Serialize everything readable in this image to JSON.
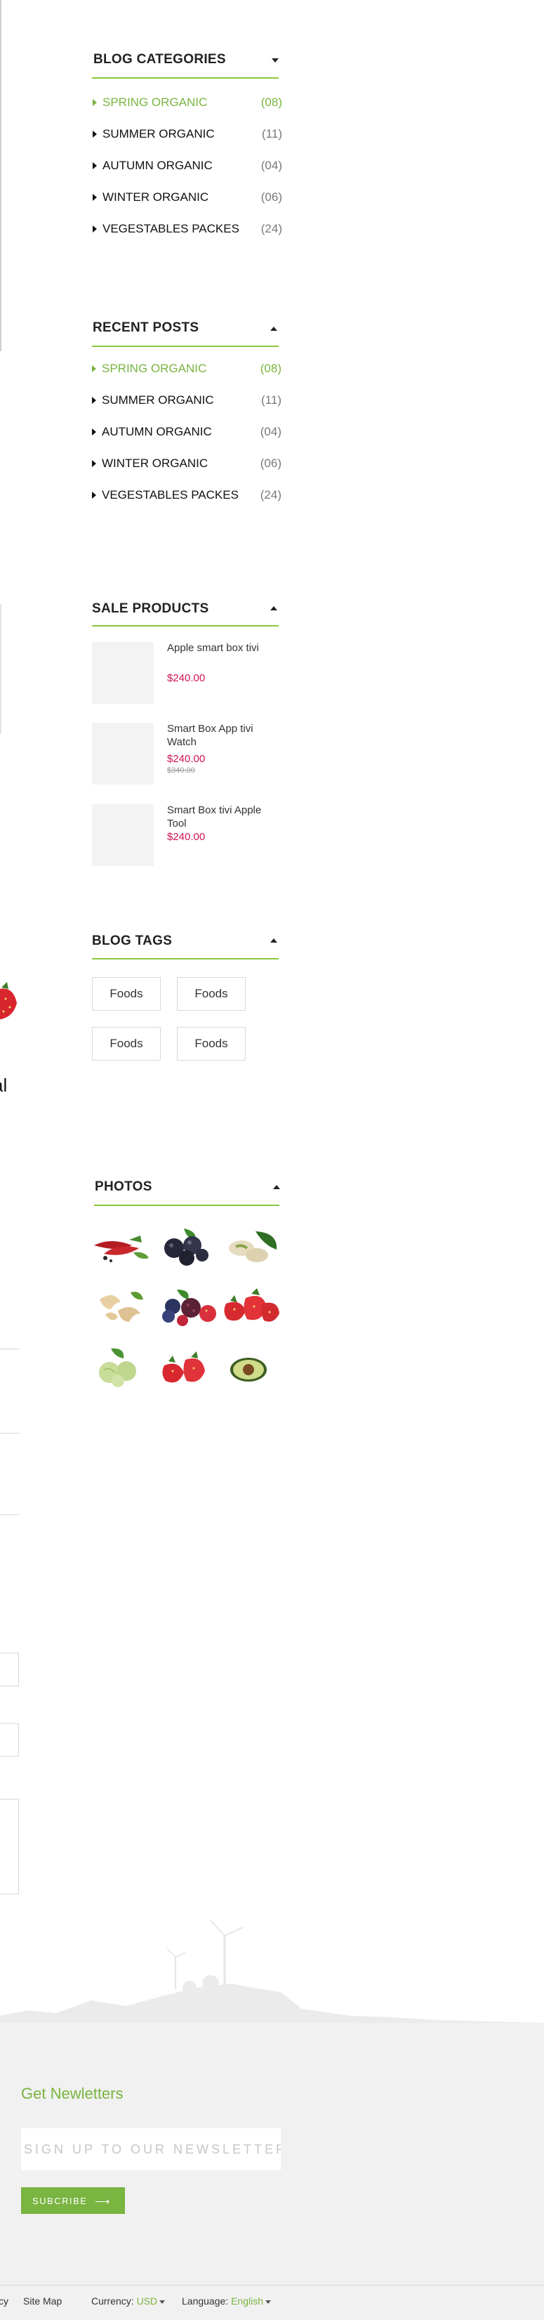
{
  "blog_categories": {
    "title": "BLOG CATEGORIES",
    "items": [
      {
        "label": "SPRING ORGANIC",
        "count": "(08)"
      },
      {
        "label": "SUMMER ORGANIC",
        "count": "(11)"
      },
      {
        "label": "AUTUMN ORGANIC",
        "count": "(04)"
      },
      {
        "label": "WINTER ORGANIC",
        "count": "(06)"
      },
      {
        "label": "VEGESTABLES PACKES",
        "count": "(24)"
      }
    ]
  },
  "recent_posts": {
    "title": "RECENT POSTS",
    "items": [
      {
        "label": "SPRING ORGANIC",
        "count": "(08)"
      },
      {
        "label": "SUMMER ORGANIC",
        "count": "(11)"
      },
      {
        "label": "AUTUMN ORGANIC",
        "count": "(04)"
      },
      {
        "label": "WINTER ORGANIC",
        "count": "(06)"
      },
      {
        "label": "VEGESTABLES PACKES",
        "count": "(24)"
      }
    ]
  },
  "sale_products": {
    "title": "SALE PRODUCTS",
    "items": [
      {
        "name": "Apple smart box tivi",
        "price": "$240.00",
        "old_price": ""
      },
      {
        "name": "Smart Box App tivi Watch",
        "price": "$240.00",
        "old_price": "$340.00"
      },
      {
        "name": "Smart Box tivi Apple Tool",
        "price": "$240.00",
        "old_price": ""
      }
    ]
  },
  "blog_tags": {
    "title": "BLOG TAGS",
    "tags": [
      "Foods",
      "Foods",
      "Foods",
      "Foods"
    ]
  },
  "photos": {
    "title": "PHOTOS",
    "items": [
      "chili-peppers",
      "blueberries",
      "pistachios",
      "cashews",
      "mixed-berries",
      "strawberries",
      "gooseberries",
      "strawberries-2",
      "avocado"
    ]
  },
  "left_fragment": {
    "text": "al"
  },
  "newsletter": {
    "title": "Get Newletters",
    "placeholder": "SIGN UP TO OUR NEWSLETTER",
    "button_label": "SUBCRIBE"
  },
  "bottom_bar": {
    "cut_link": "cy",
    "sitemap": "Site Map",
    "currency_label": "Currency:",
    "currency_value": "USD",
    "language_label": "Language:",
    "language_value": "English"
  },
  "colors": {
    "accent": "#7ab441",
    "price": "#d0134f",
    "footer_bg": "#f1f1f1"
  }
}
